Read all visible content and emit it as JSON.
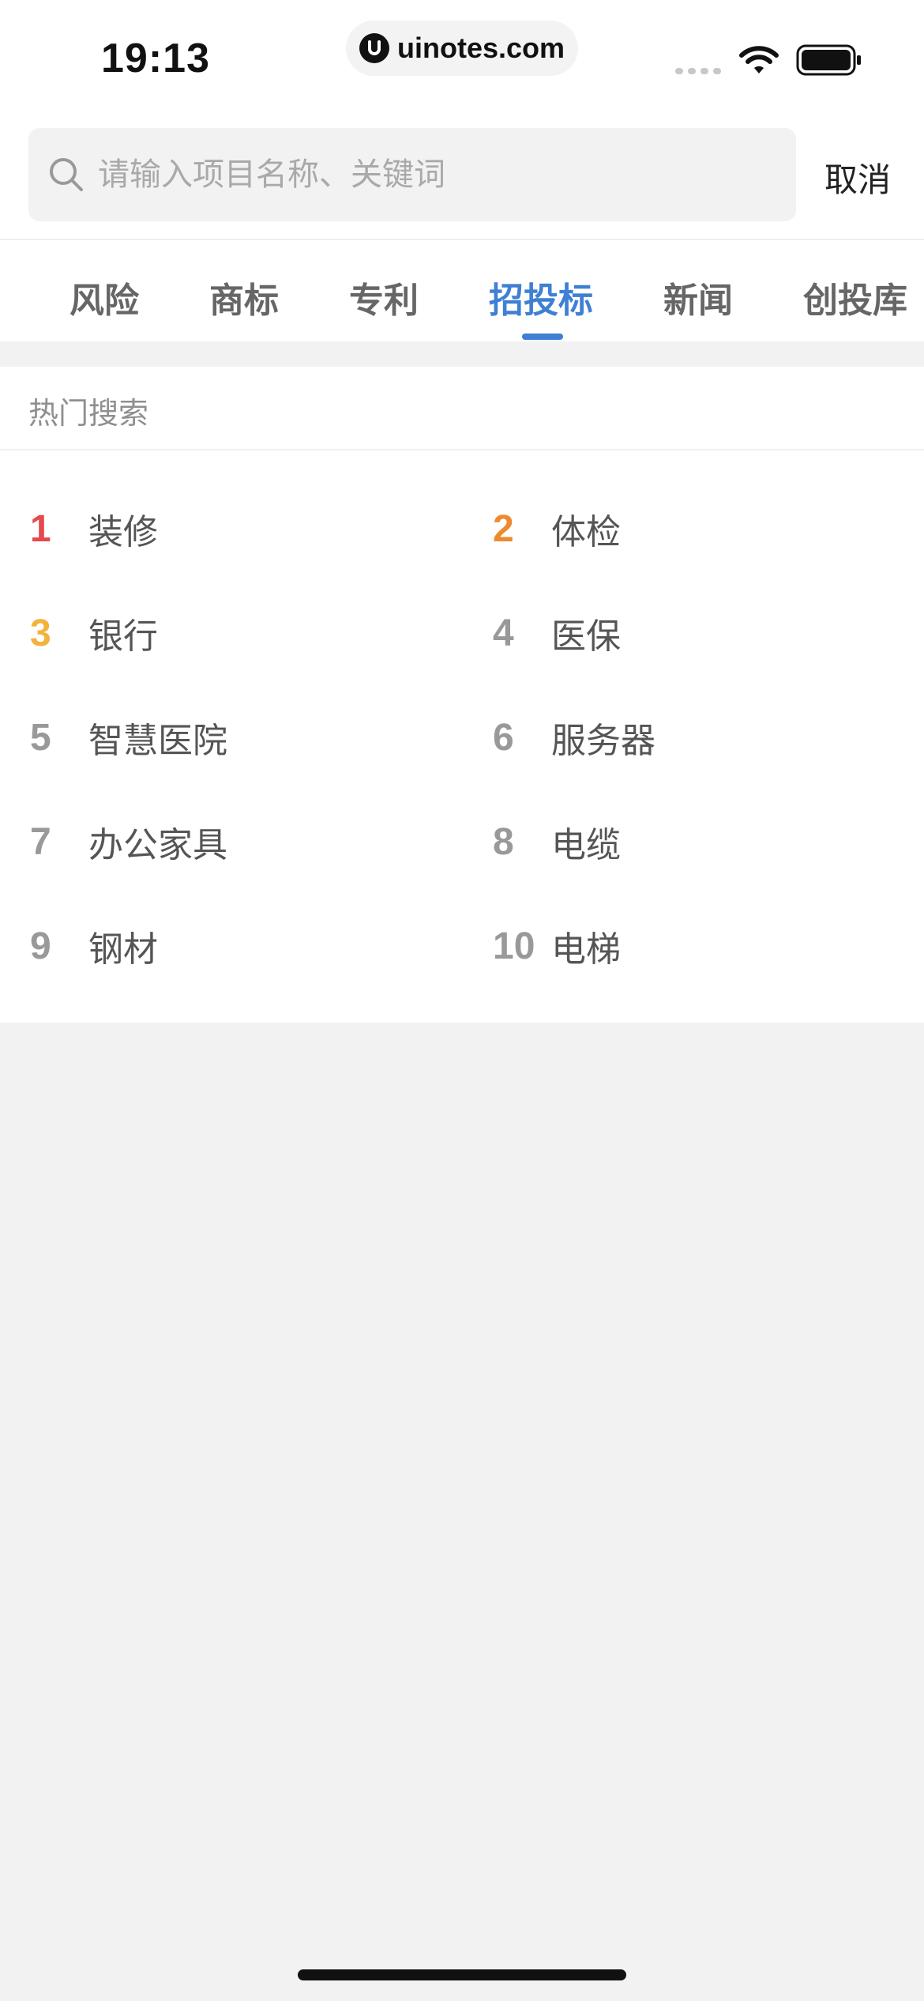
{
  "status_bar": {
    "time": "19:13",
    "url": "uinotes.com",
    "icons": [
      "cellular-signal-icon",
      "wifi-icon",
      "battery-icon"
    ]
  },
  "search": {
    "placeholder": "请输入项目名称、关键词",
    "value": "",
    "cancel_label": "取消"
  },
  "tabs": [
    {
      "label": "风险",
      "active": false
    },
    {
      "label": "商标",
      "active": false
    },
    {
      "label": "专利",
      "active": false
    },
    {
      "label": "招投标",
      "active": true
    },
    {
      "label": "新闻",
      "active": false
    },
    {
      "label": "创投库",
      "active": false
    }
  ],
  "hot_search": {
    "title": "热门搜索",
    "items": [
      {
        "rank": "1",
        "text": "装修",
        "rank_color": "#e5484d"
      },
      {
        "rank": "2",
        "text": "体检",
        "rank_color": "#ee8a2e"
      },
      {
        "rank": "3",
        "text": "银行",
        "rank_color": "#f2b33d"
      },
      {
        "rank": "4",
        "text": "医保",
        "rank_color": "#999999"
      },
      {
        "rank": "5",
        "text": "智慧医院",
        "rank_color": "#999999"
      },
      {
        "rank": "6",
        "text": "服务器",
        "rank_color": "#999999"
      },
      {
        "rank": "7",
        "text": "办公家具",
        "rank_color": "#999999"
      },
      {
        "rank": "8",
        "text": "电缆",
        "rank_color": "#999999"
      },
      {
        "rank": "9",
        "text": "钢材",
        "rank_color": "#999999"
      },
      {
        "rank": "10",
        "text": "电梯",
        "rank_color": "#999999"
      }
    ]
  },
  "colors": {
    "accent": "#3f7fd4",
    "background": "#f2f2f2"
  }
}
